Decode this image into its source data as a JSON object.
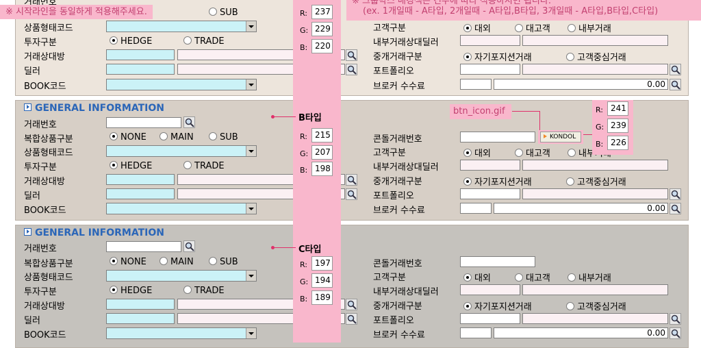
{
  "notes": {
    "left": "※ 시작라인을 동일하게 적용해주세요.",
    "right_line1": "※ 그룹박스 배경색은 건수에 따라 적용하시면 됩니다.",
    "right_line2": "(ex. 1개일때 - A타입, 2개일때 - A타입,B타입, 3개일때 - A타입,B타입,C타입)",
    "btn_icon": "btn_icon.gif",
    "btn_label": "KONDOL"
  },
  "section_title": "GENERAL INFORMATION",
  "labels": {
    "trade_no": "거래번호",
    "complex": "복합상품구분",
    "product_code": "상품형태코드",
    "invest": "투자구분",
    "counterparty": "거래상대방",
    "dealer": "딜러",
    "book": "BOOK코드",
    "kondol": "콘돌거래번호",
    "customer": "고객구분",
    "internal_dealer": "내부거래상대딜러",
    "brokerage": "중개거래구분",
    "portfolio": "포트폴리오",
    "broker_fee": "브로커 수수료"
  },
  "radios": {
    "complex": [
      "NONE",
      "MAIN",
      "SUB"
    ],
    "invest": [
      "HEDGE",
      "TRADE"
    ],
    "customer": [
      "대외",
      "대고객",
      "내부거래"
    ],
    "brokerage": [
      "자기포지션거래",
      "고객중심거래"
    ]
  },
  "fee_value": "0.00",
  "types": {
    "b": "B타입",
    "c": "C타입"
  },
  "rgb_labels": [
    "R:",
    "G:",
    "B:"
  ],
  "colors": {
    "a": {
      "r": "237",
      "g": "229",
      "b": "220",
      "hex": "#ede5dc"
    },
    "b": {
      "r": "215",
      "g": "207",
      "b": "198",
      "hex": "#d7cfc6"
    },
    "c": {
      "r": "197",
      "g": "194",
      "b": "189",
      "hex": "#c5c2bd"
    },
    "btn": {
      "r": "241",
      "g": "239",
      "b": "226",
      "hex": "#f1efe2"
    }
  }
}
